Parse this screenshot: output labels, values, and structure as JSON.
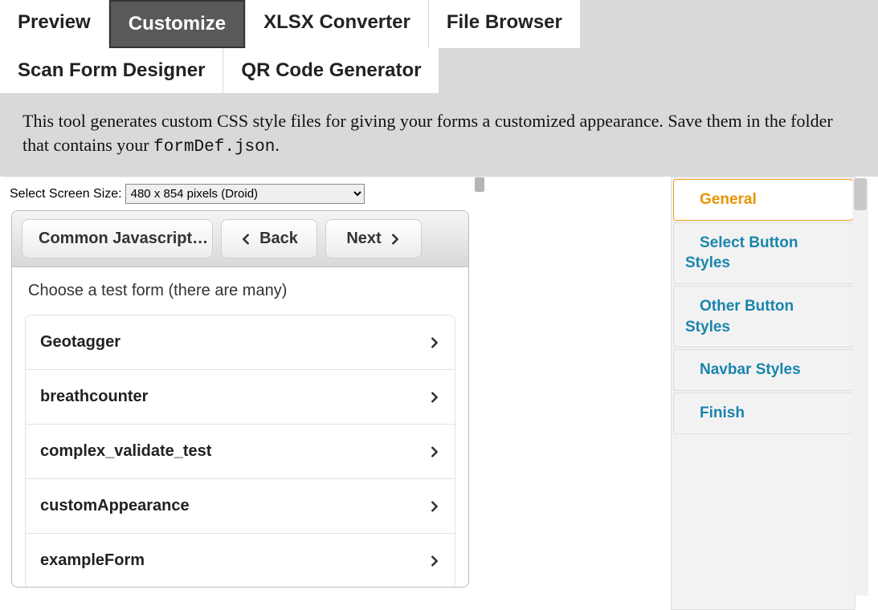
{
  "tabs": {
    "row1": [
      {
        "label": "Preview",
        "active": false
      },
      {
        "label": "Customize",
        "active": true
      },
      {
        "label": "XLSX Converter",
        "active": false
      },
      {
        "label": "File Browser",
        "active": false
      }
    ],
    "row2": [
      {
        "label": "Scan Form Designer",
        "active": false
      },
      {
        "label": "QR Code Generator",
        "active": false
      }
    ]
  },
  "description": {
    "text_before": "This tool generates custom CSS style files for giving your forms a customized appearance. Save them in the folder that contains your ",
    "code": "formDef.json",
    "text_after": "."
  },
  "screenSize": {
    "label": "Select Screen Size:",
    "selected": "480 x 854 pixels (Droid)",
    "options": [
      "480 x 854 pixels (Droid)"
    ]
  },
  "toolbar": {
    "title": "Common Javascript…",
    "back": "Back",
    "next": "Next"
  },
  "form": {
    "heading": "Choose a test form (there are many)",
    "items": [
      "Geotagger",
      "breathcounter",
      "complex_validate_test",
      "customAppearance",
      "exampleForm"
    ]
  },
  "sidebar": {
    "items": [
      {
        "label": "General",
        "active": true,
        "multiline": false
      },
      {
        "label_line1": "Select Button",
        "label_line2": "Styles",
        "active": false,
        "multiline": true
      },
      {
        "label_line1": "Other Button",
        "label_line2": "Styles",
        "active": false,
        "multiline": true
      },
      {
        "label": "Navbar Styles",
        "active": false,
        "multiline": false
      },
      {
        "label": "Finish",
        "active": false,
        "multiline": false
      }
    ]
  }
}
